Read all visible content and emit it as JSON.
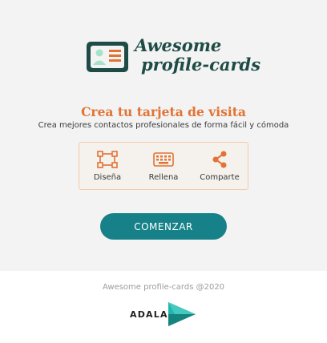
{
  "logo": {
    "line1": "Awesome",
    "line2": "profile-cards",
    "icon": "id-card-icon",
    "colors": {
      "dark": "#1e4b45",
      "light": "#a3e3c8",
      "accent": "#e17334"
    }
  },
  "hero": {
    "title": "Crea tu tarjeta de visita",
    "subtitle": "Crea mejores contactos profesionales de forma fácil y cómoda"
  },
  "steps": [
    {
      "label": "Diseña",
      "icon": "design-object-icon"
    },
    {
      "label": "Rellena",
      "icon": "keyboard-icon"
    },
    {
      "label": "Comparte",
      "icon": "share-icon"
    }
  ],
  "cta": {
    "label": "COMENZAR",
    "color": "#168188"
  },
  "footer": {
    "copyright": "Awesome profile-cards @2020",
    "brand": "ADALAB"
  },
  "colors": {
    "background": "#f3f3f3",
    "orange": "#e17334"
  }
}
